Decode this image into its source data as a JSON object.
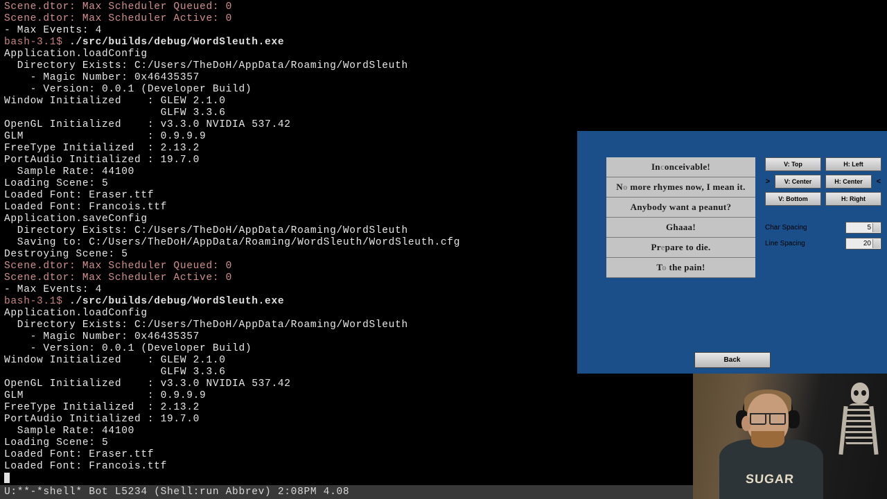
{
  "terminal": {
    "lines": [
      {
        "cls": "pink",
        "t": "Scene.dtor: Max Scheduler Queued: 0"
      },
      {
        "cls": "pink",
        "t": "Scene.dtor: Max Scheduler Active: 0"
      },
      {
        "cls": "",
        "t": "- Max Events: 4"
      },
      {
        "cls": "cmdline",
        "prompt": "bash-3.1$ ",
        "cmd": "./src/builds/debug/WordSleuth.exe"
      },
      {
        "cls": "",
        "t": "Application.loadConfig"
      },
      {
        "cls": "",
        "t": "  Directory Exists: C:/Users/TheDoH/AppData/Roaming/WordSleuth"
      },
      {
        "cls": "",
        "t": "    - Magic Number: 0x46435357"
      },
      {
        "cls": "",
        "t": "    - Version: 0.0.1 (Developer Build)"
      },
      {
        "cls": "",
        "t": "Window Initialized    : GLEW 2.1.0"
      },
      {
        "cls": "",
        "t": "                        GLFW 3.3.6"
      },
      {
        "cls": "",
        "t": "OpenGL Initialized    : v3.3.0 NVIDIA 537.42"
      },
      {
        "cls": "",
        "t": "GLM                   : 0.9.9.9"
      },
      {
        "cls": "",
        "t": "FreeType Initialized  : 2.13.2"
      },
      {
        "cls": "",
        "t": "PortAudio Initialized : 19.7.0"
      },
      {
        "cls": "",
        "t": "  Sample Rate: 44100"
      },
      {
        "cls": "",
        "t": "Loading Scene: 5"
      },
      {
        "cls": "",
        "t": "Loaded Font: Eraser.ttf"
      },
      {
        "cls": "",
        "t": "Loaded Font: Francois.ttf"
      },
      {
        "cls": "",
        "t": "Application.saveConfig"
      },
      {
        "cls": "",
        "t": "  Directory Exists: C:/Users/TheDoH/AppData/Roaming/WordSleuth"
      },
      {
        "cls": "",
        "t": "  Saving to: C:/Users/TheDoH/AppData/Roaming/WordSleuth/WordSleuth.cfg"
      },
      {
        "cls": "",
        "t": "Destroying Scene: 5"
      },
      {
        "cls": "pink",
        "t": "Scene.dtor: Max Scheduler Queued: 0"
      },
      {
        "cls": "pink",
        "t": "Scene.dtor: Max Scheduler Active: 0"
      },
      {
        "cls": "",
        "t": "- Max Events: 4"
      },
      {
        "cls": "cmdline",
        "prompt": "bash-3.1$ ",
        "cmd": "./src/builds/debug/WordSleuth.exe"
      },
      {
        "cls": "",
        "t": "Application.loadConfig"
      },
      {
        "cls": "",
        "t": "  Directory Exists: C:/Users/TheDoH/AppData/Roaming/WordSleuth"
      },
      {
        "cls": "",
        "t": "    - Magic Number: 0x46435357"
      },
      {
        "cls": "",
        "t": "    - Version: 0.0.1 (Developer Build)"
      },
      {
        "cls": "",
        "t": "Window Initialized    : GLEW 2.1.0"
      },
      {
        "cls": "",
        "t": "                        GLFW 3.3.6"
      },
      {
        "cls": "",
        "t": "OpenGL Initialized    : v3.3.0 NVIDIA 537.42"
      },
      {
        "cls": "",
        "t": "GLM                   : 0.9.9.9"
      },
      {
        "cls": "",
        "t": "FreeType Initialized  : 2.13.2"
      },
      {
        "cls": "",
        "t": "PortAudio Initialized : 19.7.0"
      },
      {
        "cls": "",
        "t": "  Sample Rate: 44100"
      },
      {
        "cls": "",
        "t": "Loading Scene: 5"
      },
      {
        "cls": "",
        "t": "Loaded Font: Eraser.ttf"
      },
      {
        "cls": "",
        "t": "Loaded Font: Francois.ttf"
      }
    ]
  },
  "statusbar": "U:**-*shell*      Bot L5234  (Shell:run Abbrev) 2:08PM 4.08",
  "app": {
    "items": [
      "Inconceivable!",
      "No more rhymes now, I mean it.",
      "Anybody want a peanut?",
      "Ghaaa!",
      "Prepare to die.",
      "To the pain!"
    ],
    "buttons": {
      "vtop": "V: Top",
      "hleft": "H: Left",
      "vcenter": "V: Center",
      "hcenter": "H: Center",
      "vbottom": "V: Bottom",
      "hright": "H: Right"
    },
    "char_spacing_label": "Char Spacing",
    "char_spacing_value": "5",
    "line_spacing_label": "Line Spacing",
    "line_spacing_value": "20",
    "back": "Back",
    "arrow": ">"
  },
  "webcam": {
    "shirt": "SUGAR"
  }
}
